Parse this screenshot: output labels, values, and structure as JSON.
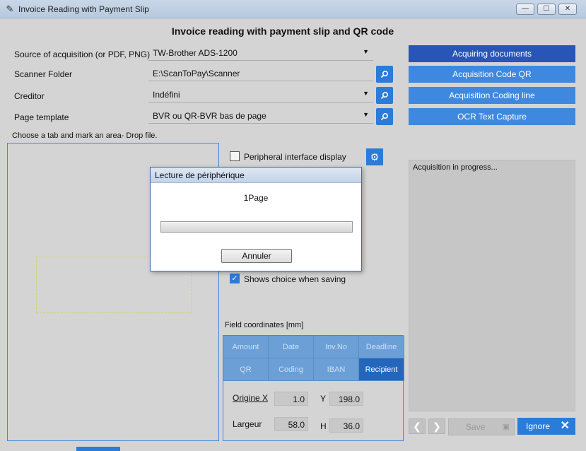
{
  "window": {
    "title": "Invoice Reading with Payment Slip",
    "minimize_glyph": "—",
    "maximize_glyph": "☐",
    "close_glyph": "✕"
  },
  "heading": "Invoice reading with payment slip and QR code",
  "form": {
    "source_label": "Source of acquisition (or PDF, PNG)",
    "source_value": "TW-Brother ADS-1200",
    "folder_label": "Scanner Folder",
    "folder_value": "E:\\ScanToPay\\Scanner",
    "creditor_label": "Creditor",
    "creditor_value": "Indéfini",
    "template_label": "Page template",
    "template_value": "BVR ou QR-BVR bas de page"
  },
  "actions": {
    "acquiring": "Acquiring documents",
    "qr": "Acquisition Code QR",
    "coding_line": "Acquisition Coding line",
    "ocr": "OCR Text Capture"
  },
  "drop_label": "Choose a tab and mark an area- Drop file.",
  "options": {
    "peripheral": "Peripheral interface display",
    "peripheral_checked": false,
    "shows_choice": "Shows choice when saving",
    "shows_choice_checked": true
  },
  "status_text": "Acquisition in progress...",
  "field_coords_label": "Field coordinates [mm]",
  "tabs": [
    {
      "label": "Amount",
      "active": false
    },
    {
      "label": "Date",
      "active": false
    },
    {
      "label": "Inv.No",
      "active": false
    },
    {
      "label": "Deadline",
      "active": false
    },
    {
      "label": "QR",
      "active": false
    },
    {
      "label": "Coding",
      "active": false
    },
    {
      "label": "IBAN",
      "active": false
    },
    {
      "label": "Recipient",
      "active": true
    }
  ],
  "coords": {
    "origin_x_label": "Origine X",
    "origin_x_value": "1.0",
    "y_label": "Y",
    "y_value": "198.0",
    "width_label": "Largeur",
    "width_value": "58.0",
    "h_label": "H",
    "h_value": "36.0"
  },
  "bottom": {
    "prev_glyph": "❮",
    "next_glyph": "❯",
    "save": "Save",
    "ignore": "Ignore"
  },
  "dialog": {
    "title": "Lecture de périphérique",
    "message": "1Page",
    "progress": 0.0,
    "cancel": "Annuler"
  },
  "icons": {
    "search": "search-icon",
    "gear": "gear-icon",
    "dropdown": "chevron-down-icon"
  },
  "colors": {
    "accent": "#2b7bd8",
    "primary_button": "#2755b8",
    "tab_active": "#2466bb",
    "tab_inactive": "#6b9fd6"
  }
}
